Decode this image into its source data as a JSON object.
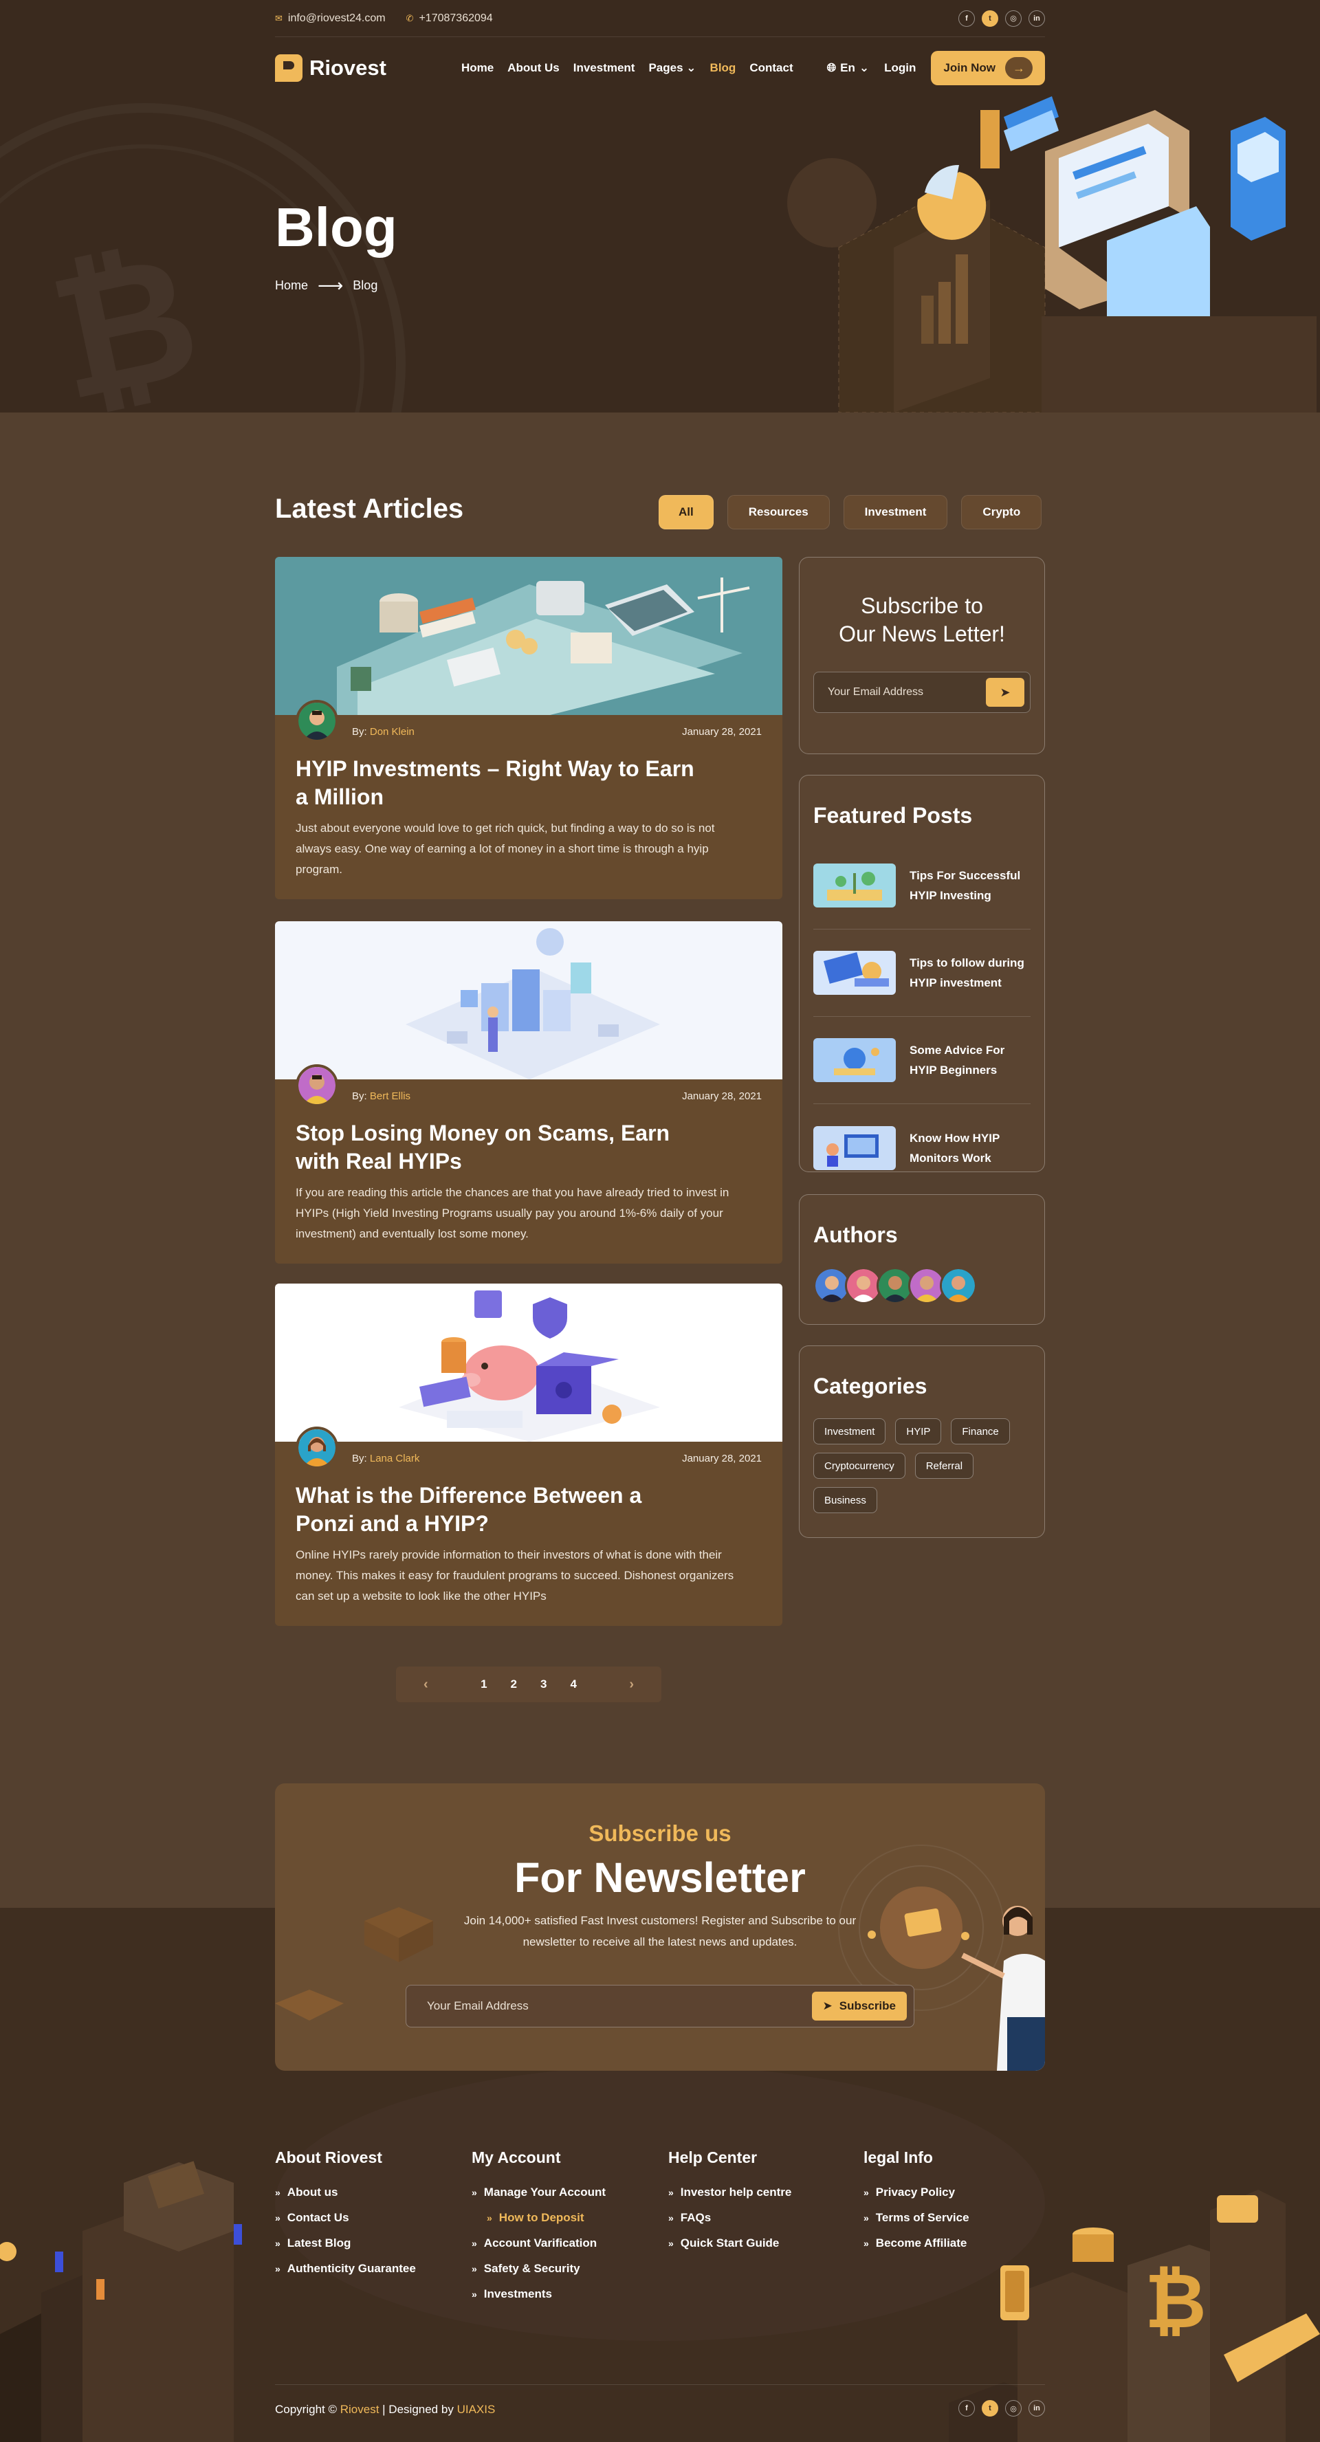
{
  "topbar": {
    "email": "info@riovest24.com",
    "phone": "+17087362094",
    "socials": [
      "f",
      "t",
      "ig",
      "in"
    ]
  },
  "nav": {
    "brand": "Riovest",
    "links": [
      "Home",
      "About Us",
      "Investment",
      "Pages",
      "Blog",
      "Contact"
    ],
    "active": "Blog",
    "language": "En",
    "login": "Login",
    "join": "Join Now"
  },
  "hero": {
    "title": "Blog",
    "breadcrumb_home": "Home",
    "breadcrumb_current": "Blog"
  },
  "articles_section": {
    "title": "Latest Articles",
    "filters": [
      "All",
      "Resources",
      "Investment",
      "Crypto"
    ],
    "active_filter": "All"
  },
  "articles": [
    {
      "by_label": "By:",
      "author": "Don Klein",
      "date": "January 28, 2021",
      "title": "HYIP Investments – Right Way to Earn a Million",
      "excerpt": "Just about everyone would love to get rich quick, but finding a way to do so is not always easy. One way of earning a lot of money in a short time is through a hyip program."
    },
    {
      "by_label": "By:",
      "author": "Bert Ellis",
      "date": "January 28, 2021",
      "title": "Stop Losing Money on Scams, Earn with Real HYIPs",
      "excerpt": "If you are reading this article the chances are that you have already tried to invest in HYIPs (High Yield Investing Programs usually pay you around 1%-6% daily of your investment) and eventually lost some money."
    },
    {
      "by_label": "By:",
      "author": "Lana Clark",
      "date": "January 28, 2021",
      "title": "What is the Difference Between a Ponzi and a HYIP?",
      "excerpt": "Online HYIPs rarely provide information to their investors of what is done with their money. This makes it easy for fraudulent programs to succeed. Dishonest organizers can set up a website to look like the other HYIPs"
    }
  ],
  "sidebar": {
    "subscribe_title_1": "Subscribe to",
    "subscribe_title_2": "Our News Letter!",
    "subscribe_placeholder": "Your Email Address",
    "featured_title": "Featured Posts",
    "featured": [
      "Tips For Successful HYIP Investing",
      "Tips to follow during HYIP investment",
      "Some Advice For HYIP Beginners",
      "Know How HYIP Monitors Work"
    ],
    "authors_title": "Authors",
    "categories_title": "Categories",
    "categories": [
      "Investment",
      "HYIP",
      "Finance",
      "Cryptocurrency",
      "Referral",
      "Business"
    ]
  },
  "pagination": {
    "prev": "‹",
    "pages": [
      "1",
      "2",
      "3",
      "4"
    ],
    "next": "›"
  },
  "newsletter": {
    "subtitle": "Subscribe us",
    "title": "For Newsletter",
    "description": "Join 14,000+ satisfied Fast Invest customers! Register and Subscribe to our newsletter to receive all the latest news and updates.",
    "placeholder": "Your Email Address",
    "button": "Subscribe"
  },
  "footer": {
    "columns": [
      {
        "title": "About Riovest",
        "items": [
          "About us",
          "Contact Us",
          "Latest Blog",
          "Authenticity Guarantee"
        ]
      },
      {
        "title": "My Account",
        "items": [
          "Manage Your Account",
          "How to Deposit",
          "Account Varification",
          "Safety & Security",
          "Investments"
        ]
      },
      {
        "title": "Help Center",
        "items": [
          "Investor help centre",
          "FAQs",
          "Quick Start Guide"
        ]
      },
      {
        "title": "legal Info",
        "items": [
          "Privacy Policy",
          "Terms of Service",
          "Become Affiliate"
        ]
      }
    ],
    "copyright_prefix": "Copyright ©",
    "copyright_brand": "Riovest",
    "copyright_mid": "| Designed by",
    "copyright_designer": "UIAXIS"
  },
  "colors": {
    "accent": "#f0b95a",
    "hero_bg": "#3a2a1e",
    "main_bg": "#54402f",
    "card_bg": "#664a2d",
    "footer_bg": "#3f2e20"
  }
}
